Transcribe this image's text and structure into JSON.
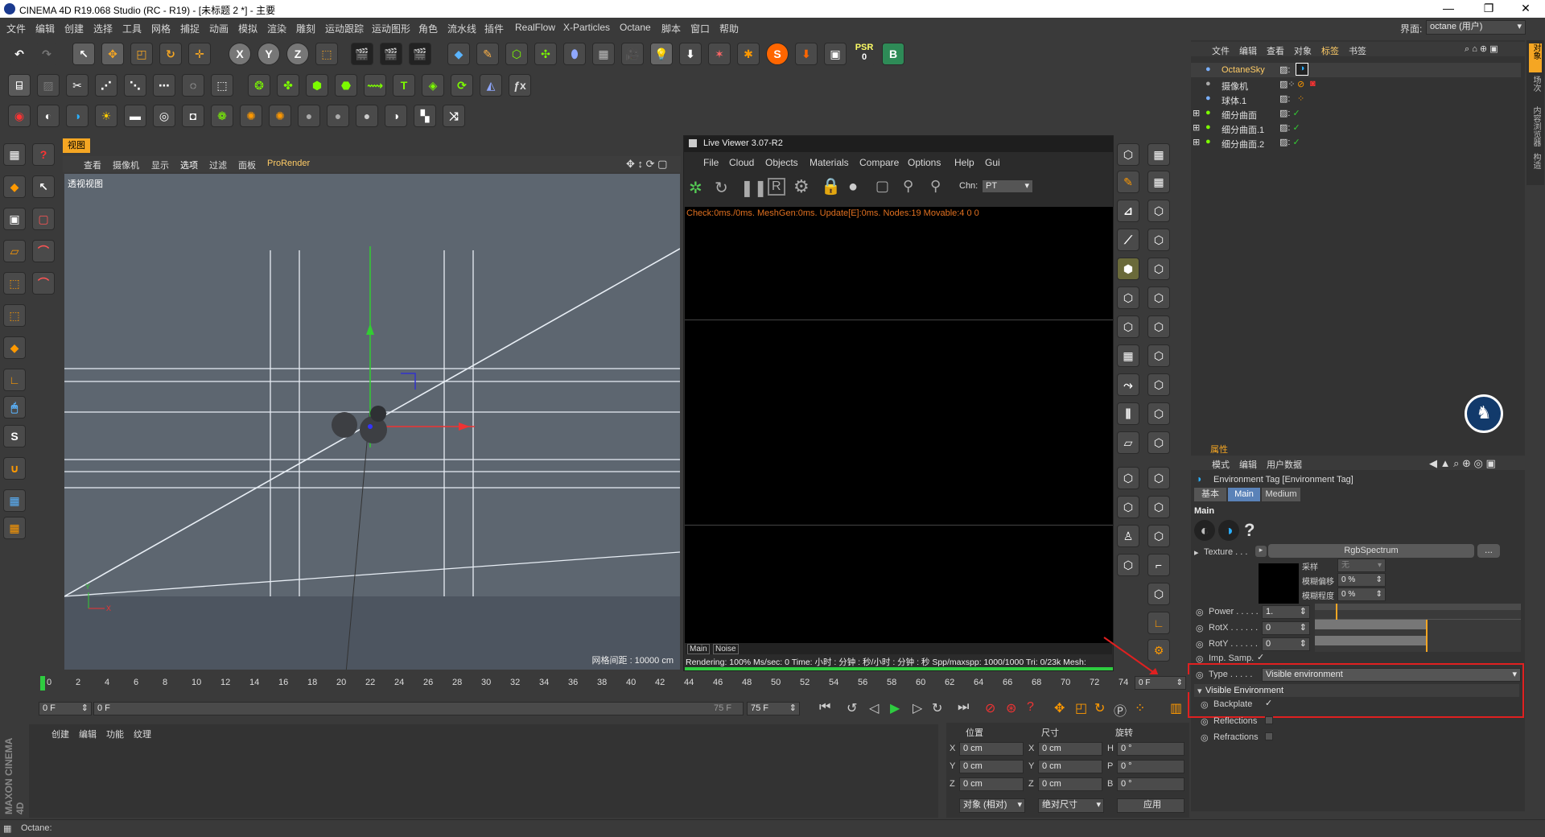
{
  "window": {
    "title": "CINEMA 4D R19.068 Studio (RC - R19) - [未标题 2 *] - 主要",
    "min": "—",
    "max": "❐",
    "close": "✕"
  },
  "menu": [
    "文件",
    "编辑",
    "创建",
    "选择",
    "工具",
    "网格",
    "捕捉",
    "动画",
    "模拟",
    "渲染",
    "雕刻",
    "运动跟踪",
    "运动图形",
    "角色",
    "流水线",
    "插件",
    "RealFlow",
    "X-Particles",
    "Octane",
    "脚本",
    "窗口",
    "帮助"
  ],
  "layout": {
    "label": "界面:",
    "value": "octane (用户)"
  },
  "toolbar_axes": [
    "X",
    "Y",
    "Z"
  ],
  "psr": {
    "label": "PSR",
    "value": "0"
  },
  "viewport": {
    "header_items": [
      "查看",
      "摄像机",
      "显示",
      "选项",
      "过滤",
      "面板",
      "ProRender"
    ],
    "tab": "视图",
    "label": "透视视图",
    "grid_info": "网格间距 : 10000 cm",
    "axis_y": "Y",
    "axis_x": "X"
  },
  "liveviewer": {
    "title": "Live Viewer 3.07-R2",
    "menu": [
      "File",
      "Cloud",
      "Objects",
      "Materials",
      "Compare",
      "Options",
      "Help",
      "Gui"
    ],
    "chn_label": "Chn:",
    "chn_value": "PT",
    "status_line": "Check:0ms./0ms. MeshGen:0ms. Update[E]:0ms. Nodes:19 Movable:4  0 0",
    "tabs": [
      "Main",
      "Noise"
    ],
    "render_info": "Rendering: 100%   Ms/sec: 0   Time: 小时 : 分钟 : 秒/小时 : 分钟 : 秒   Spp/maxspp: 1000/1000  Tri: 0/23k   Mesh:"
  },
  "object_manager": {
    "menu": [
      "文件",
      "编辑",
      "查看",
      "对象",
      "标签",
      "书签"
    ],
    "objects": [
      {
        "name": "OctaneSky",
        "highlight": true
      },
      {
        "name": "摄像机",
        "highlight": false
      },
      {
        "name": "球体.1",
        "highlight": false
      },
      {
        "name": "细分曲面",
        "highlight": false
      },
      {
        "name": "细分曲面.1",
        "highlight": false
      },
      {
        "name": "细分曲面.2",
        "highlight": false
      }
    ],
    "side_tabs": [
      "对象",
      "场次",
      "内容浏览器",
      "构造"
    ]
  },
  "attributes": {
    "header": "属性",
    "menu": [
      "模式",
      "编辑",
      "用户数据"
    ],
    "tag_title": "Environment Tag [Environment Tag]",
    "tabs": [
      "基本",
      "Main",
      "Medium"
    ],
    "section": "Main",
    "texture_label": "Texture . . .",
    "texture_value": "RgbSpectrum",
    "texture_more": "...",
    "sampling_label": "采样",
    "sampling_value": "无",
    "blur_offset_label": "模糊偏移",
    "blur_offset_value": "0 %",
    "blur_degree_label": "模糊程度",
    "blur_degree_value": "0 %",
    "power_label": "Power . . . . .",
    "power_value": "1.",
    "rotx_label": "RotX . . . . . .",
    "rotx_value": "0",
    "roty_label": "RotY . . . . . .",
    "roty_value": "0",
    "impsamp_label": "Imp. Samp.",
    "type_label": "Type . . . . .",
    "type_value": "Visible environment",
    "visible_env_section": "Visible Environment",
    "backplate_label": "Backplate",
    "reflections_label": "Reflections",
    "refractions_label": "Refractions"
  },
  "timeline": {
    "ticks": [
      "0",
      "2",
      "4",
      "6",
      "8",
      "10",
      "12",
      "14",
      "16",
      "18",
      "20",
      "22",
      "24",
      "26",
      "28",
      "30",
      "32",
      "34",
      "36",
      "38",
      "40",
      "42",
      "44",
      "46",
      "48",
      "50",
      "52",
      "54",
      "56",
      "58",
      "60",
      "62",
      "64",
      "66",
      "68",
      "70",
      "72",
      "74"
    ],
    "current": "0 F",
    "start": "0 F",
    "range_start": "0 F",
    "range_end": "75 F",
    "end": "75 F"
  },
  "material_manager": {
    "menu": [
      "创建",
      "编辑",
      "功能",
      "纹理"
    ]
  },
  "coords": {
    "headers": [
      "位置",
      "尺寸",
      "旋转"
    ],
    "rows": [
      {
        "a": "X",
        "pos": "0 cm",
        "b": "X",
        "size": "0 cm",
        "c": "H",
        "rot": "0 °"
      },
      {
        "a": "Y",
        "pos": "0 cm",
        "b": "Y",
        "size": "0 cm",
        "c": "P",
        "rot": "0 °"
      },
      {
        "a": "Z",
        "pos": "0 cm",
        "b": "Z",
        "size": "0 cm",
        "c": "B",
        "rot": "0 °"
      }
    ],
    "mode": "对象 (相对)",
    "size_mode": "绝对尺寸",
    "apply": "应用"
  },
  "status": "Octane:",
  "brand": "MAXON CINEMA 4D"
}
